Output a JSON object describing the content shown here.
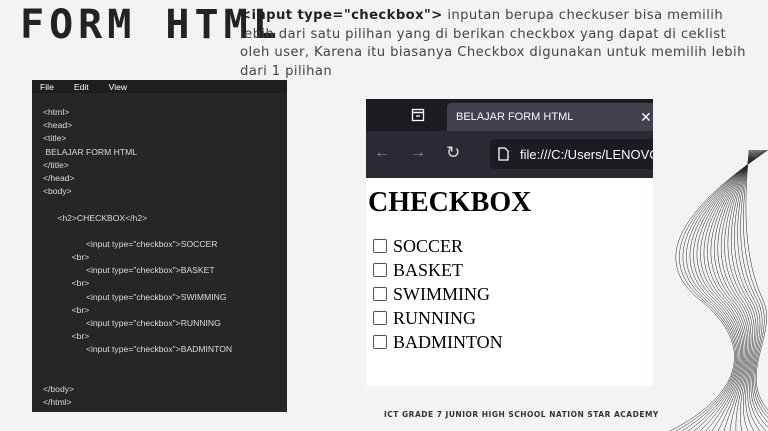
{
  "slide": {
    "title": "FORM HTML",
    "desc_code": "<input type=\"checkbox\">",
    "desc_text": " inputan berupa checkuser bisa memilih lebih dari satu pilihan yang di berikan checkbox yang dapat di ceklist oleh user, Karena itu biasanya Checkbox digunakan untuk memilih lebih dari 1 pilihan",
    "footer": "ICT GRADE 7 JUNIOR HIGH SCHOOL NATION STAR ACADEMY"
  },
  "editor": {
    "menu": [
      "File",
      "Edit",
      "View"
    ],
    "lines": [
      "<html>",
      "<head>",
      "<title>",
      " BELAJAR FORM HTML",
      "</title>",
      "</head>",
      "<body>",
      "",
      "      <h2>CHECKBOX</h2>",
      "",
      "                  <input type=\"checkbox\">SOCCER",
      "            <br>",
      "                  <input type=\"checkbox\">BASKET",
      "            <br>",
      "                  <input type=\"checkbox\">SWIMMING",
      "            <br>",
      "                  <input type=\"checkbox\">RUNNING",
      "            <br>",
      "                  <input type=\"checkbox\">BADMINTON",
      "",
      "",
      "</body>",
      "</html>"
    ]
  },
  "browser": {
    "tab_title": "BELAJAR FORM HTML",
    "url": "file:///C:/Users/LENOVO",
    "heading": "CHECKBOX",
    "options": [
      "SOCCER",
      "BASKET",
      "SWIMMING",
      "RUNNING",
      "BADMINTON"
    ]
  }
}
